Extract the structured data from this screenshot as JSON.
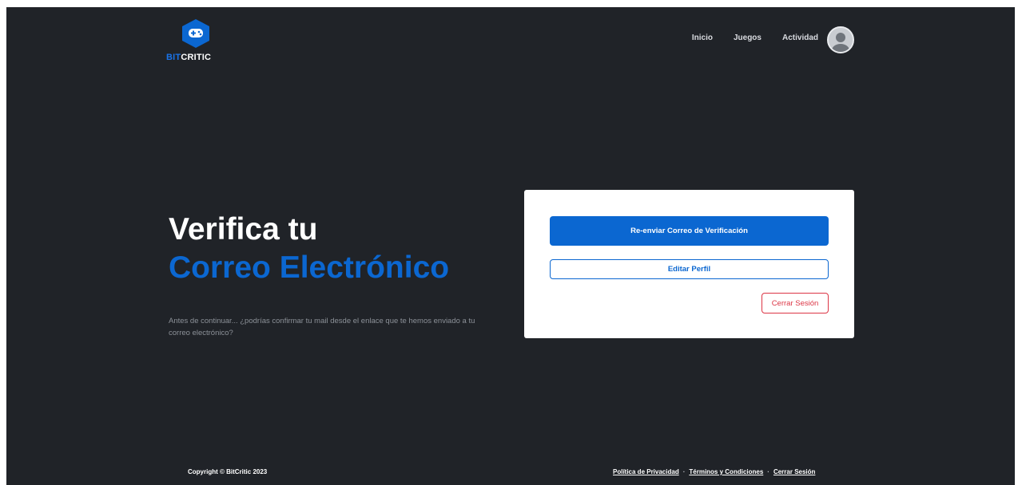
{
  "brand": {
    "logo_part1": "BIT",
    "logo_part2": "CRITIC",
    "accent_color": "#0b67d1"
  },
  "nav": {
    "items": [
      "Inicio",
      "Juegos",
      "Actividad"
    ],
    "avatar_icon": "user-avatar-icon"
  },
  "hero": {
    "title_line1": "Verifica tu",
    "title_line2": "Correo Electrónico",
    "subtitle": "Antes de continuar... ¿podrías confirmar tu mail desde el enlace que te hemos enviado a tu correo electrónico?"
  },
  "card": {
    "resend_label": "Re-enviar Correo de Verificación",
    "edit_label": "Editar Perfil",
    "logout_label": "Cerrar Sesión"
  },
  "footer": {
    "copyright": "Copyright © BitCritic 2023",
    "links": [
      "Política de Privacidad",
      "Términos y Condiciones",
      "Cerrar Sesión"
    ],
    "separator": "·"
  },
  "colors": {
    "background": "#202328",
    "primary": "#0b67d1",
    "danger": "#dc3545"
  }
}
